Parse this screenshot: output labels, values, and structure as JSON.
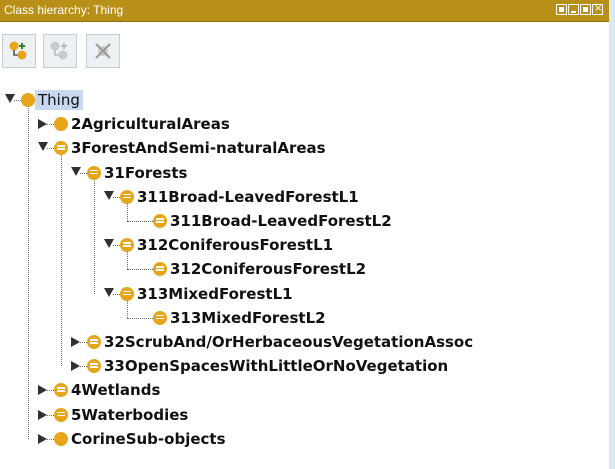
{
  "window": {
    "title": "Class hierarchy: Thing",
    "controls": [
      "restore",
      "minimize",
      "maximize",
      "close"
    ]
  },
  "toolbar": {
    "buttons": [
      {
        "icon": "add-subclass-icon",
        "enabled": true
      },
      {
        "icon": "add-sibling-class-icon",
        "enabled": false
      },
      {
        "icon": "delete-class-icon",
        "enabled": false
      }
    ]
  },
  "tree": {
    "nodes": [
      {
        "label": "Thing",
        "depth": 0,
        "expander": "open",
        "icon": "primitive",
        "selected": true
      },
      {
        "label": "2AgriculturalAreas",
        "depth": 1,
        "expander": "closed",
        "icon": "primitive"
      },
      {
        "label": "3ForestAndSemi-naturalAreas",
        "depth": 1,
        "expander": "open",
        "icon": "defined"
      },
      {
        "label": "31Forests",
        "depth": 2,
        "expander": "open",
        "icon": "defined"
      },
      {
        "label": "311Broad-LeavedForestL1",
        "depth": 3,
        "expander": "open",
        "icon": "defined"
      },
      {
        "label": "311Broad-LeavedForestL2",
        "depth": 4,
        "expander": "none",
        "icon": "defined"
      },
      {
        "label": "312ConiferousForestL1",
        "depth": 3,
        "expander": "open",
        "icon": "defined"
      },
      {
        "label": "312ConiferousForestL2",
        "depth": 4,
        "expander": "none",
        "icon": "defined"
      },
      {
        "label": "313MixedForestL1",
        "depth": 3,
        "expander": "open",
        "icon": "defined"
      },
      {
        "label": "313MixedForestL2",
        "depth": 4,
        "expander": "none",
        "icon": "defined"
      },
      {
        "label": "32ScrubAnd/OrHerbaceousVegetationAssoc",
        "depth": 2,
        "expander": "closed",
        "icon": "defined"
      },
      {
        "label": "33OpenSpacesWithLittleOrNoVegetation",
        "depth": 2,
        "expander": "closed",
        "icon": "defined"
      },
      {
        "label": "4Wetlands",
        "depth": 1,
        "expander": "closed",
        "icon": "defined"
      },
      {
        "label": "5Waterbodies",
        "depth": 1,
        "expander": "closed",
        "icon": "defined"
      },
      {
        "label": "CorineSub-objects",
        "depth": 1,
        "expander": "closed",
        "icon": "primitive"
      }
    ]
  },
  "colors": {
    "titlebar": "#b89018",
    "class_icon": "#e6a51a",
    "selection": "#c8d8ee",
    "background": "#dbe9f2"
  }
}
